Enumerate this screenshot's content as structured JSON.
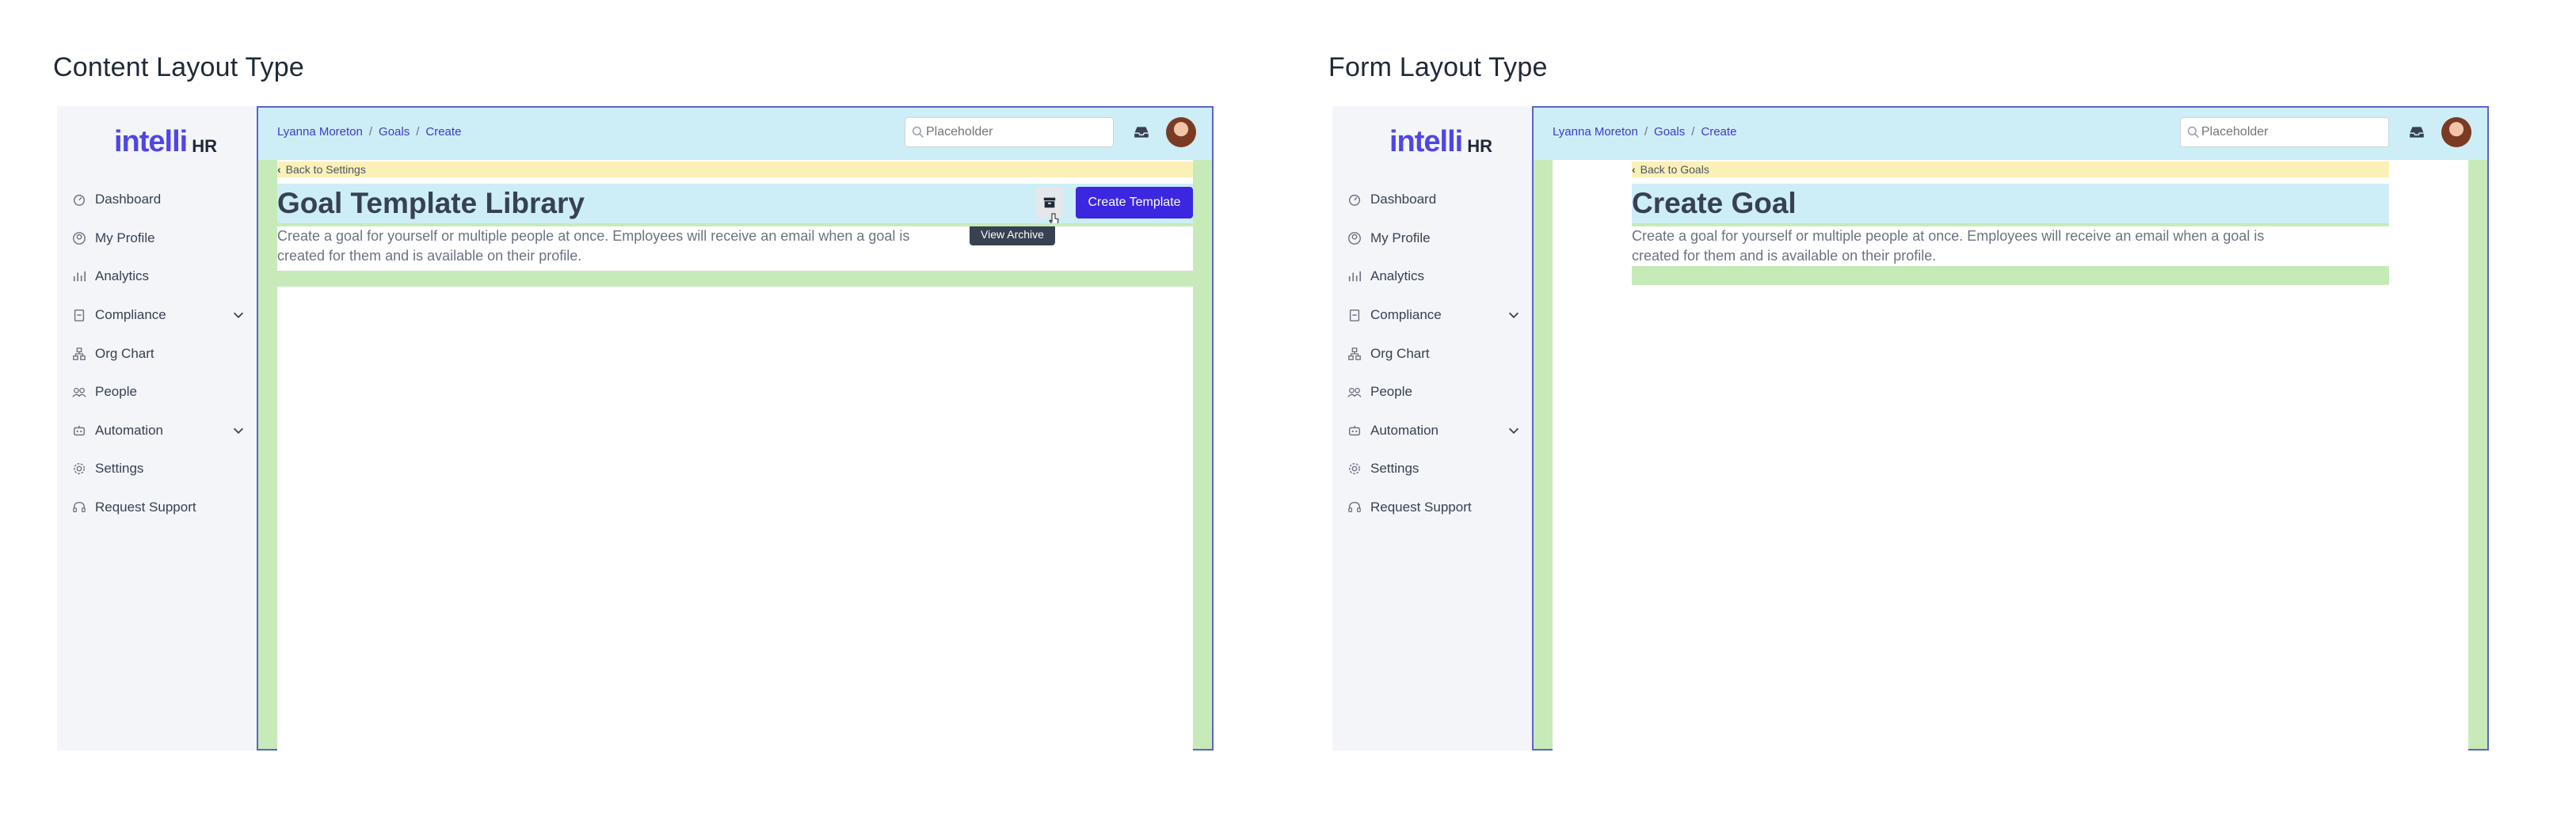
{
  "panels": [
    {
      "section_title": "Content Layout Type",
      "logo": {
        "main": "intelli",
        "sub": "HR"
      },
      "breadcrumb": [
        "Lyanna Moreton",
        "Goals",
        "Create"
      ],
      "search_placeholder": "Placeholder",
      "back_link": "Back to Settings",
      "page_title": "Goal Template Library",
      "description": "Create a goal for yourself or multiple people at once. Employees will receive an email when a goal is created for them and is available on their profile.",
      "primary_button": "Create Template",
      "tooltip": "View Archive"
    },
    {
      "section_title": "Form Layout Type",
      "logo": {
        "main": "intelli",
        "sub": "HR"
      },
      "breadcrumb": [
        "Lyanna Moreton",
        "Goals",
        "Create"
      ],
      "search_placeholder": "Placeholder",
      "back_link": "Back to Goals",
      "page_title": "Create Goal",
      "description": "Create a goal for yourself or multiple people at once. Employees will receive an email when a goal is created for them and is available on their profile."
    }
  ],
  "nav_items": [
    {
      "label": "Dashboard",
      "icon": "dashboard-icon",
      "expandable": false
    },
    {
      "label": "My Profile",
      "icon": "profile-icon",
      "expandable": false
    },
    {
      "label": "Analytics",
      "icon": "analytics-icon",
      "expandable": false
    },
    {
      "label": "Compliance",
      "icon": "compliance-icon",
      "expandable": true
    },
    {
      "label": "Org Chart",
      "icon": "org-chart-icon",
      "expandable": false
    },
    {
      "label": "People",
      "icon": "people-icon",
      "expandable": false
    },
    {
      "label": "Automation",
      "icon": "automation-icon",
      "expandable": true
    },
    {
      "label": "Settings",
      "icon": "settings-icon",
      "expandable": false
    },
    {
      "label": "Request Support",
      "icon": "support-icon",
      "expandable": false
    }
  ],
  "colors": {
    "accent": "#3b27e0",
    "logo": "#4f46e5",
    "topbar": "#cdeef6",
    "back_strip": "#fbf0b8",
    "padding_green": "#c6ebb9",
    "sidebar_bg": "#f4f5f9",
    "frame_border": "#5b63c8"
  }
}
